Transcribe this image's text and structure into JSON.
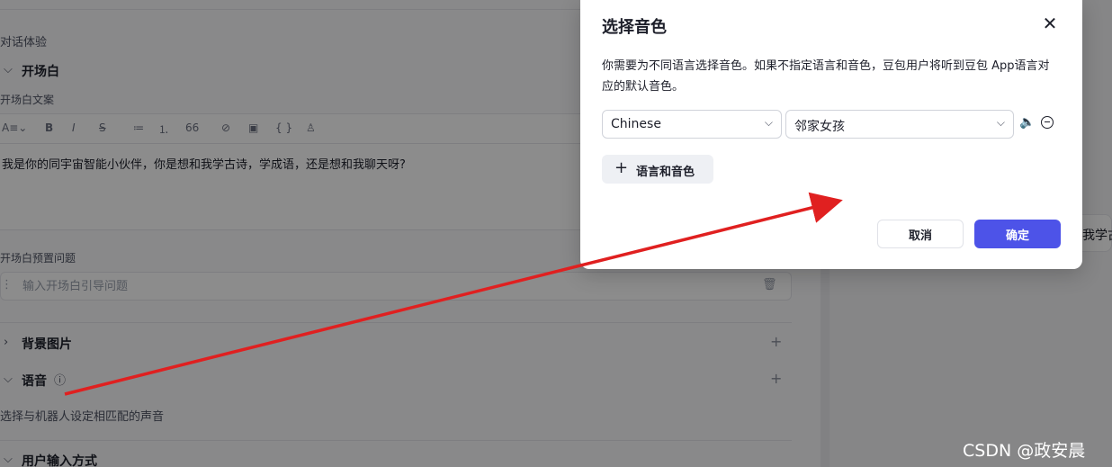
{
  "background_page": {
    "section_chat": "对话体验",
    "opener": {
      "title": "开场白",
      "text_label": "开场白文案",
      "toolbar": [
        "A",
        "B",
        "I",
        "S",
        "≔",
        "⒈",
        "66",
        "⊘",
        "▣",
        "{ }",
        "♙"
      ],
      "content": "我是你的同宇宙智能小伙伴，你是想和我学古诗，学成语，还是想和我聊天呀?",
      "preset_label": "开场白预置问题",
      "preset_placeholder": "输入开场白引导问题"
    },
    "background_image": "背景图片",
    "voice": {
      "title": "语音",
      "hint": "选择与机器人设定相匹配的声音"
    },
    "user_input": "用户输入方式",
    "right_preview_text": "我学古"
  },
  "modal": {
    "title": "选择音色",
    "description": "你需要为不同语言选择音色。如果不指定语言和音色，豆包用户将听到豆包 App语言对应的默认音色。",
    "language_value": "Chinese",
    "voice_value": "邻家女孩",
    "add_label": "语言和音色",
    "cancel_label": "取消",
    "confirm_label": "确定"
  },
  "watermark": "CSDN @政安晨",
  "colors": {
    "primary": "#4d53e8",
    "annotation_arrow": "#e02020"
  }
}
